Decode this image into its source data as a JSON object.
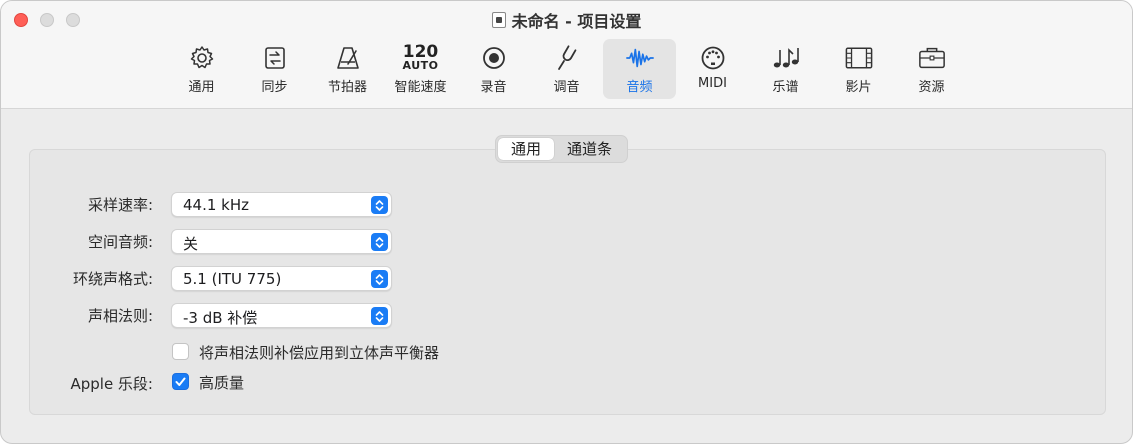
{
  "window": {
    "title": "未命名 - 项目设置"
  },
  "toolbar": {
    "items": [
      {
        "label": "通用",
        "icon": "gear-icon"
      },
      {
        "label": "同步",
        "icon": "sync-icon"
      },
      {
        "label": "节拍器",
        "icon": "metronome-icon"
      },
      {
        "label": "智能速度",
        "icon": "smart-tempo-icon",
        "tempo": "120",
        "auto": "AUTO"
      },
      {
        "label": "录音",
        "icon": "record-icon"
      },
      {
        "label": "调音",
        "icon": "tuning-fork-icon"
      },
      {
        "label": "音频",
        "icon": "waveform-icon",
        "active": true
      },
      {
        "label": "MIDI",
        "icon": "midi-icon"
      },
      {
        "label": "乐谱",
        "icon": "score-icon"
      },
      {
        "label": "影片",
        "icon": "film-icon"
      },
      {
        "label": "资源",
        "icon": "briefcase-icon"
      }
    ]
  },
  "tabs": {
    "items": [
      {
        "label": "通用",
        "selected": true
      },
      {
        "label": "通道条",
        "selected": false
      }
    ]
  },
  "settings": {
    "sample_rate": {
      "label": "采样速率:",
      "value": "44.1 kHz"
    },
    "spatial_audio": {
      "label": "空间音频:",
      "value": "关"
    },
    "surround_format": {
      "label": "环绕声格式:",
      "value": "5.1 (ITU 775)"
    },
    "pan_law": {
      "label": "声相法则:",
      "value": "-3 dB 补偿"
    },
    "pan_law_stereo": {
      "label": "将声相法则补偿应用到立体声平衡器",
      "checked": false
    },
    "apple_loops": {
      "label": "Apple 乐段:",
      "checkbox_label": "高质量",
      "checked": true
    }
  },
  "colors": {
    "accent": "#1a7cf5",
    "close": "#ff5f57"
  }
}
